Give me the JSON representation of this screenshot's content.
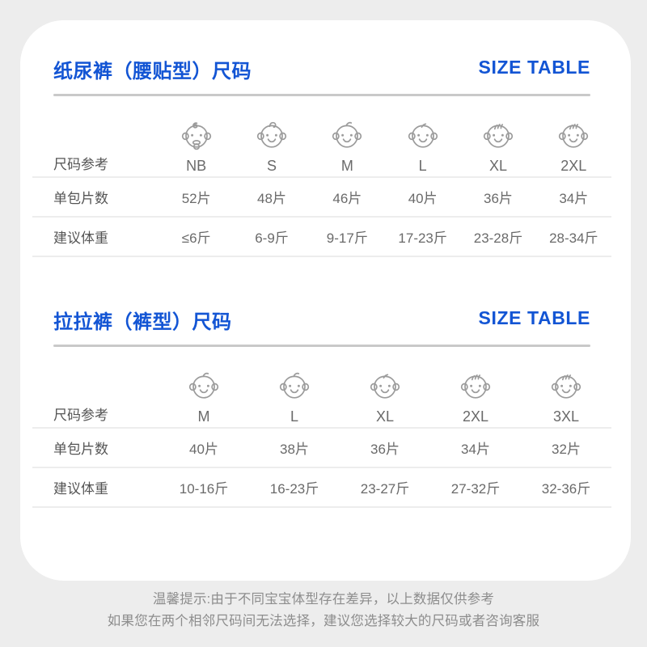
{
  "card": {
    "background_color": "#ffffff",
    "page_background_color": "#ededed",
    "accent_color": "#1355d4",
    "text_color": "#6a6a6a"
  },
  "sections": [
    {
      "title": "纸尿裤（腰贴型）尺码",
      "title_en": "SIZE TABLE",
      "row_labels": {
        "size": "尺码参考",
        "count": "单包片数",
        "weight": "建议体重"
      },
      "sizes": [
        "NB",
        "S",
        "M",
        "L",
        "XL",
        "2XL"
      ],
      "icons": [
        "baby-face-swirl-pacifier-icon",
        "baby-face-curl-icon",
        "baby-face-strand-icon",
        "baby-face-shorthair-icon",
        "baby-face-hair3-icon",
        "baby-face-hair3-icon"
      ],
      "counts": [
        "52片",
        "48片",
        "46片",
        "40片",
        "36片",
        "34片"
      ],
      "weights": [
        "≤6斤",
        "6-9斤",
        "9-17斤",
        "17-23斤",
        "23-28斤",
        "28-34斤"
      ]
    },
    {
      "title": "拉拉裤（裤型）尺码",
      "title_en": "SIZE TABLE",
      "row_labels": {
        "size": "尺码参考",
        "count": "单包片数",
        "weight": "建议体重"
      },
      "sizes": [
        "M",
        "L",
        "XL",
        "2XL",
        "3XL"
      ],
      "icons": [
        "baby-face-strand-icon",
        "baby-face-strand-icon",
        "baby-face-shorthair-icon",
        "baby-face-hair3-icon",
        "baby-face-hair3-icon"
      ],
      "counts": [
        "40片",
        "38片",
        "36片",
        "34片",
        "32片"
      ],
      "weights": [
        "10-16斤",
        "16-23斤",
        "23-27斤",
        "27-32斤",
        "32-36斤"
      ]
    }
  ],
  "footer": {
    "line1": "温馨提示:由于不同宝宝体型存在差异，以上数据仅供参考",
    "line2": "如果您在两个相邻尺码间无法选择，建议您选择较大的尺码或者咨询客服"
  }
}
